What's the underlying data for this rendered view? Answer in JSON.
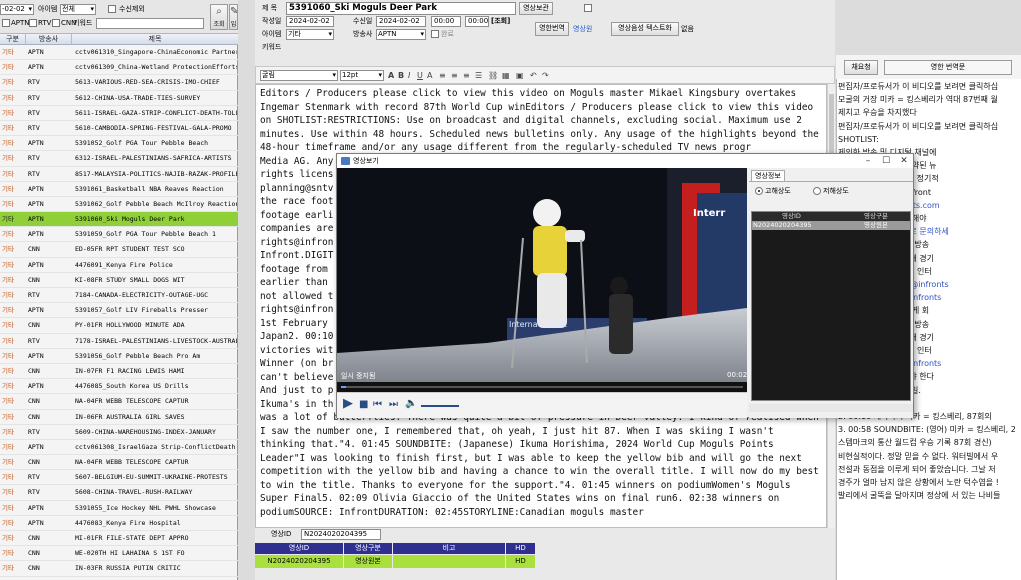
{
  "left": {
    "toolbar": {
      "date_value": "-02-02",
      "item_label": "아이템",
      "item_value": "전체",
      "unreceived_label": "수신제외",
      "aptn_label": "APTN",
      "rtv_label": "RTV",
      "cnn_label": "CNN",
      "keyword_label": "키워드",
      "query_button": "조회",
      "input_button": "입력"
    },
    "columns": [
      "구분",
      "방송사",
      "제목"
    ],
    "rows": [
      [
        "기타",
        "APTN",
        "cctv061310_Singapore-ChinaEconomic Partnership"
      ],
      [
        "기타",
        "APTN",
        "cctv061309_China-Wetland ProtectionEfforts"
      ],
      [
        "기타",
        "RTV",
        "5613-VARIOUS-RED-SEA-CRISIS-IMO-CHIEF"
      ],
      [
        "기타",
        "RTV",
        "5612-CHINA-USA-TRADE-TIES-SURVEY"
      ],
      [
        "기타",
        "RTV",
        "5611-ISRAEL-GAZA-STRIP-CONFLICT-DEATH-TOLL"
      ],
      [
        "기타",
        "RTV",
        "5610-CAMBODIA-SPRING-FESTIVAL-GALA-PROMO"
      ],
      [
        "기타",
        "APTN",
        "5391052_Golf PGA Tour Pebble Beach"
      ],
      [
        "기타",
        "RTV",
        "6312-ISRAEL-PALESTINIANS-SAFRICA-ARTISTS"
      ],
      [
        "기타",
        "RTV",
        "8517-MALAYSIA-POLITICS-NAJIB-RAZAK-PROFILE"
      ],
      [
        "기타",
        "APTN",
        "5391061_Basketball NBA Reaves Reaction"
      ],
      [
        "기타",
        "APTN",
        "5391062_Golf Pebble Beach McIlroy Reaction"
      ],
      [
        "기타",
        "APTN",
        "5391060_Ski Moguls Deer Park"
      ],
      [
        "기타",
        "APTN",
        "5391059_Golf PGA Tour Pebble Beach 1"
      ],
      [
        "기타",
        "CNN",
        "ED-05FR RPT STUDENT TEST SCO"
      ],
      [
        "기타",
        "APTN",
        "4476091_Kenya Fire Police"
      ],
      [
        "기타",
        "CNN",
        "KI-08FR STUDY SMALL DOGS WIT"
      ],
      [
        "기타",
        "RTV",
        "7184-CANADA-ELECTRICITY-OUTAGE-UGC"
      ],
      [
        "기타",
        "APTN",
        "5391057_Golf LIV Fireballs Presser"
      ],
      [
        "기타",
        "CNN",
        "PY-01FR HOLLYWOOD MINUTE ADA"
      ],
      [
        "기타",
        "RTV",
        "7178-ISRAEL-PALESTINIANS-LIVESTOCK-AUSTRALIA"
      ],
      [
        "기타",
        "APTN",
        "5391056_Golf Pebble Beach Pro Am"
      ],
      [
        "기타",
        "CNN",
        "IN-07FR F1 RACING LEWIS HAMI"
      ],
      [
        "기타",
        "APTN",
        "4476085_South Korea US Drills"
      ],
      [
        "기타",
        "CNN",
        "NA-04FR WEBB TELESCOPE CAPTUR"
      ],
      [
        "기타",
        "CNN",
        "IN-06FR AUSTRALIA GIRL SAVES"
      ],
      [
        "기타",
        "RTV",
        "5609-CHINA-WAREHOUSING-INDEX-JANUARY"
      ],
      [
        "기타",
        "APTN",
        "cctv061308_IsraelGaza Strip-ConflictDeath Toll"
      ],
      [
        "기타",
        "CNN",
        "NA-04FR WEBB TELESCOPE CAPTUR"
      ],
      [
        "기타",
        "RTV",
        "5607-BELGIUM-EU-SUMMIT-UKRAINE-PROTESTS"
      ],
      [
        "기타",
        "RTV",
        "5608-CHINA-TRAVEL-RUSH-RAILWAY"
      ],
      [
        "기타",
        "APTN",
        "5391055_Ice Hockey NHL PWHL Showcase"
      ],
      [
        "기타",
        "APTN",
        "4476083_Kenya Fire Hospital"
      ],
      [
        "기타",
        "CNN",
        "MI-01FR FILE-STATE DEPT APPRO"
      ],
      [
        "기타",
        "CNN",
        "WE-020TH HI LAHAINA S 1ST FO"
      ],
      [
        "기타",
        "CNN",
        "IN-03FR RUSSIA PUTIN CRITIC"
      ],
      [
        "기타",
        "APTN",
        "4476082_Australia Stranded Livestock"
      ]
    ],
    "selected_index": 11
  },
  "form": {
    "title_label": "제 목",
    "title_value": "5391060_Ski Moguls Deer Park",
    "video_keep_button": "영상보관",
    "created_label": "작성일",
    "created_date": "2024-02-02",
    "received_label": "수신일",
    "received_date": "2024-02-02",
    "time_from": "00:00",
    "time_to": "00:00",
    "query_button": "[조회]",
    "item_label": "아이템",
    "item_value": "기타",
    "broadcaster_label": "방송사",
    "broadcaster_value": "APTN",
    "complete_label": "완료",
    "keyword_label": "키워드",
    "tab_video_translation": "영한번역",
    "tab_transcript": "영상원",
    "tab_audio_text": "영상음성 텍스트화",
    "tab_none": "없음",
    "toolbar_font": "굴림",
    "toolbar_size": "12pt"
  },
  "editor": {
    "text": "Editors / Producers please click to view this video on Moguls master Mikael Kingsbury overtakes Ingemar Stenmark with record 87th World Cup winEditors / Producers please click to view this video on SHOTLIST:RESTRICTIONS: Use on broadcast and digital channels, excluding social. Maximum use 2 minutes. Use within 48 hours. Scheduled news bulletins only. Any usage of the highlights beyond the 48-hour timeframe and/or any usage different from the regularly-scheduled TV news progr\nMedia AG. Any\nrights licens\nplanning@sntv\nthe race foot\nfootage earli\ncompanies are\nrights@infron\nInfront.DIGIT\nfootage from \nearlier than \nnot allowed t\nrights@infron\n1st February \nJapan2. 00:10\nvictories wit\nWinner (on br\ncan't believe\nAnd just to p\nIkuma's in th\nwas a lot of butterflies. There was quite a bit of pressure in Deer Valley. I kind of realised when I saw the number one, I remembered that, oh yeah, I just hit 87. When I was skiing I wasn't thinking that.\"4. 01:45 SOUNDBITE: (Japanese) Ikuma Horishima, 2024 World Cup Moguls Points Leader\"I was looking to finish first, but I was able to keep the yellow bib and will go the next competition with the yellow bib and having a chance to win the overall title. I will now do my best to win the title. Thanks to everyone for the support.\"4. 01:45 winners on podiumWomen's Moguls Super Final5. 02:09 Olivia Giaccio of the United States wins on final run6. 02:38 winners on podiumSOURCE: InfrontDURATION: 02:45STORYLINE:Canadian moguls master"
  },
  "bottom": {
    "id_label": "영상ID",
    "id_value": "N2024020204395",
    "columns": [
      "영상ID",
      "영상구분",
      "비고",
      "HD"
    ],
    "row": [
      "N2024020204395",
      "영상원본",
      "",
      "HD"
    ]
  },
  "right": {
    "tab_summary": "채요청",
    "tab_translation": "영한 번역문",
    "lines": [
      "편집자/프로듀서가 이 비디오를 보려면 클릭하십",
      "모굴의 거장 미카 = 킹스베리가 역대 87번째 월",
      "제치고 우승을 차지했다",
      "편집자/프로듀서가 이 비디오를 보려면 클릭하십",
      "SHOTLIST:",
      "",
      "                       제외한 방송 및 디지털 채널에",
      "                       이내에 사용하세요. 예약된 뉴",
      "                       이라이트를 사용하거나 정기적",
      "                       공개와 다른 사용은 Infront",
      "                       rights@infrontsports.com",
      "                       용에 대해 주소로 지정해야",
      "                       ning@sntv.com 으로 문의하세",
      "                       이용 가능합니다. 독일 방송",
      "                       로베니아 방송사들은 해 경기",
      "                       다. 스웨덴의 온라인 및 인터",
      "                       하려면 요청도 rights@infronts",
      "                       승인 요청도 rights@infronts",
      "                       . 방송사들은 프론트에게 회",
      "                       사용 가능합니다. 독일 방송",
      "                       로베니아 방송사들은 해 경기",
      "                       다. 스웨덴의 온라인 및 인터",
      "                       승인 요청도 rights@infronts",
      "                       관한지 지구 봉패되어야 한다",
      "                       타주 - 2024년 2월 1일.",
      "                       호리시마 이쿠마",
      "2. 00:10 캐나다의 미카 = 킹스베리, 87회의",
      "3. 00:58 SOUNDBITE: (영어) 미카 = 킹스베리, 2",
      "스템마크의 통산 월드컵 우승 기록 87회 경신)",
      "비현실적이다. 정말 믿을 수 없다. 워터빌에서 우",
      "전설과 동점을 이루게 되어 좋았습니다. 그날 저",
      "경주가 얼마 남지 않은 상황에서 노란 턱수염을 !",
      "발리에서 굴뚝을 달아지며 정상에 서 있는 나비들"
    ]
  },
  "player": {
    "title": "영상보기",
    "time_current": "00:02",
    "status": "일시 중지됨",
    "side_tab": "영상정보",
    "quality_high": "고해상도",
    "quality_low": "저해상도",
    "list_headers": [
      "영상ID",
      "영상구분"
    ],
    "list_row": [
      "N2024020204395",
      "영상원본"
    ],
    "overlay_left": "Intern",
    "overlay_right": "Interr",
    "overlay_sign": "Internati Healt"
  }
}
